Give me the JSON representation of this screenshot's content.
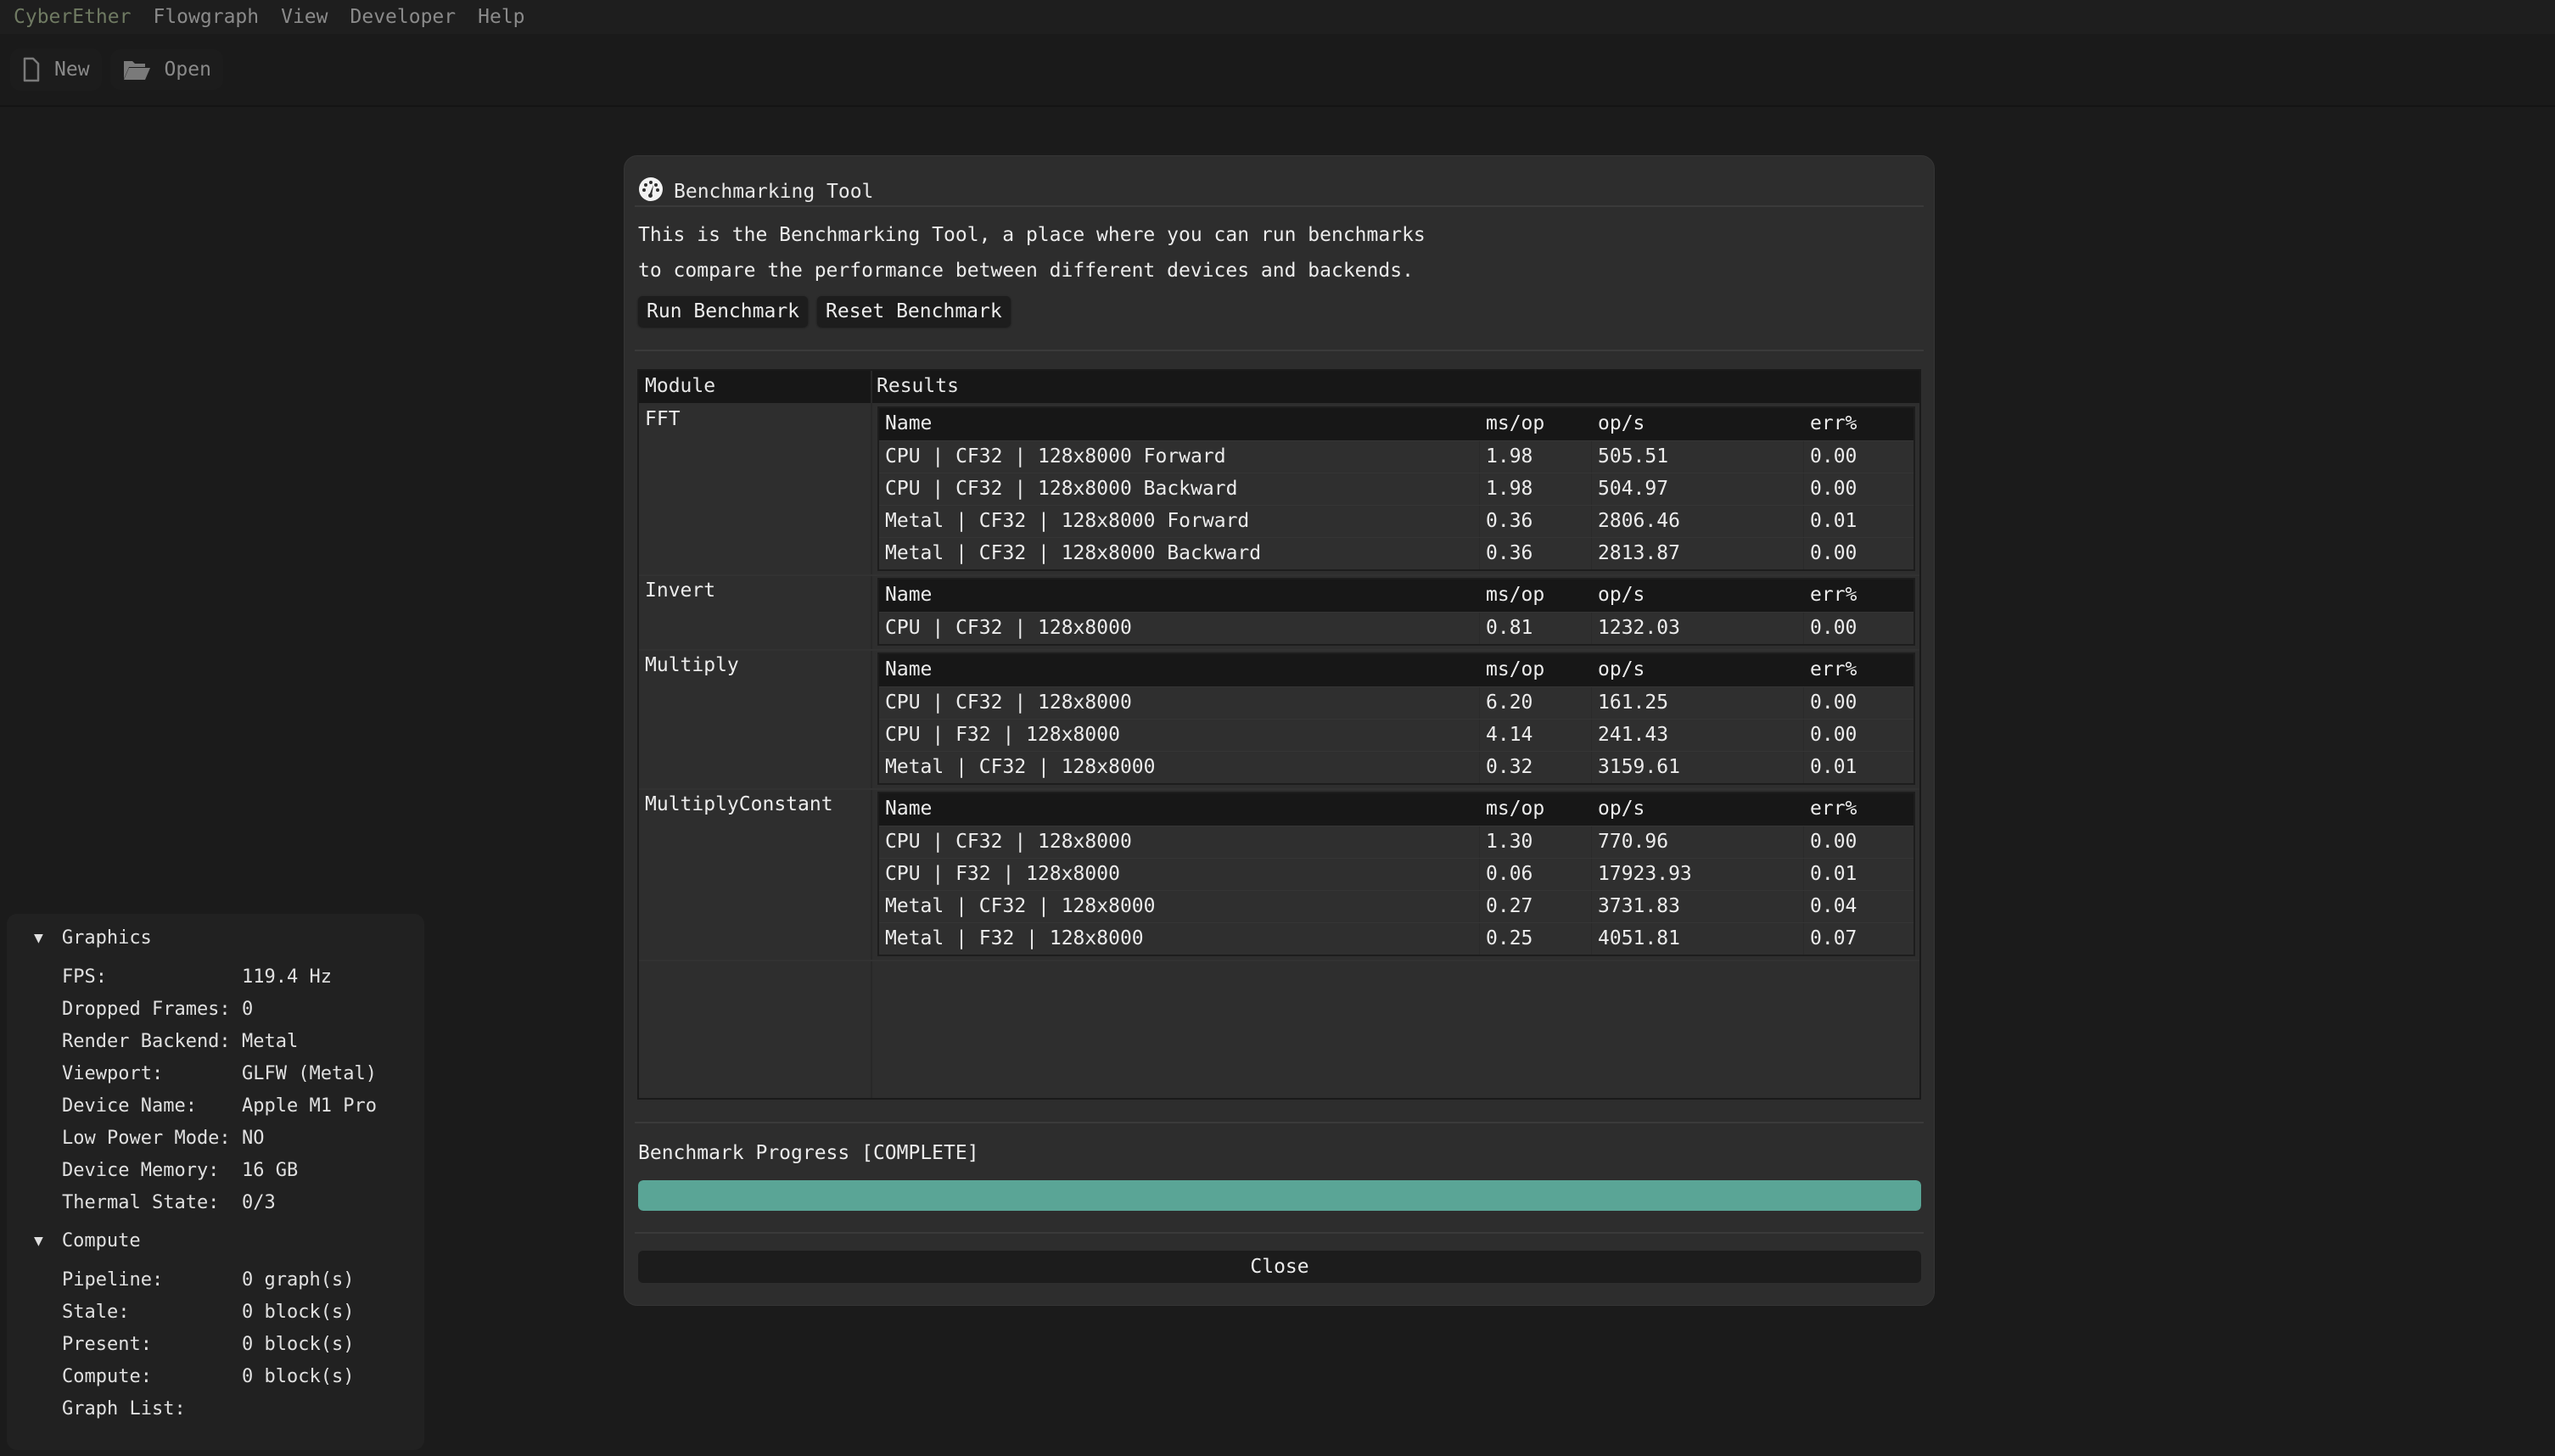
{
  "menubar": {
    "brand": "CyberEther",
    "items": [
      "Flowgraph",
      "View",
      "Developer",
      "Help"
    ]
  },
  "toolbar": {
    "new_label": "New",
    "open_label": "Open",
    "new_icon": "file-icon",
    "open_icon": "folder-open-icon"
  },
  "dialog": {
    "title": "Benchmarking Tool",
    "title_icon": "gauge-icon",
    "description_line1": "This is the Benchmarking Tool, a place where you can run benchmarks",
    "description_line2": "to compare the performance between different devices and backends.",
    "run_button": "Run Benchmark",
    "reset_button": "Reset Benchmark",
    "table": {
      "module_header": "Module",
      "results_header": "Results",
      "columns": [
        "Name",
        "ms/op",
        "op/s",
        "err%"
      ],
      "modules": [
        {
          "name": "FFT",
          "rows": [
            {
              "name": "CPU | CF32 | 128x8000 Forward",
              "ms_op": "1.98",
              "ops": "505.51",
              "err": "0.00"
            },
            {
              "name": "CPU | CF32 | 128x8000 Backward",
              "ms_op": "1.98",
              "ops": "504.97",
              "err": "0.00"
            },
            {
              "name": "Metal | CF32 | 128x8000 Forward",
              "ms_op": "0.36",
              "ops": "2806.46",
              "err": "0.01"
            },
            {
              "name": "Metal | CF32 | 128x8000 Backward",
              "ms_op": "0.36",
              "ops": "2813.87",
              "err": "0.00"
            }
          ]
        },
        {
          "name": "Invert",
          "rows": [
            {
              "name": "CPU | CF32 | 128x8000",
              "ms_op": "0.81",
              "ops": "1232.03",
              "err": "0.00"
            }
          ]
        },
        {
          "name": "Multiply",
          "rows": [
            {
              "name": "CPU | CF32 | 128x8000",
              "ms_op": "6.20",
              "ops": "161.25",
              "err": "0.00"
            },
            {
              "name": "CPU | F32 | 128x8000",
              "ms_op": "4.14",
              "ops": "241.43",
              "err": "0.00"
            },
            {
              "name": "Metal | CF32 | 128x8000",
              "ms_op": "0.32",
              "ops": "3159.61",
              "err": "0.01"
            }
          ]
        },
        {
          "name": "MultiplyConstant",
          "rows": [
            {
              "name": "CPU | CF32 | 128x8000",
              "ms_op": "1.30",
              "ops": "770.96",
              "err": "0.00"
            },
            {
              "name": "CPU | F32 | 128x8000",
              "ms_op": "0.06",
              "ops": "17923.93",
              "err": "0.01"
            },
            {
              "name": "Metal | CF32 | 128x8000",
              "ms_op": "0.27",
              "ops": "3731.83",
              "err": "0.04"
            },
            {
              "name": "Metal | F32 | 128x8000",
              "ms_op": "0.25",
              "ops": "4051.81",
              "err": "0.07"
            }
          ]
        }
      ]
    },
    "progress_label": "Benchmark Progress [COMPLETE]",
    "progress_fraction": 1.0,
    "progress_color": "#5aa596",
    "close_button": "Close"
  },
  "stats": {
    "graphics": {
      "title": "Graphics",
      "rows": [
        {
          "label": "FPS:",
          "value": "119.4 Hz"
        },
        {
          "label": "Dropped Frames:",
          "value": "0"
        },
        {
          "label": "Render Backend:",
          "value": "Metal"
        },
        {
          "label": "Viewport:",
          "value": "GLFW (Metal)"
        },
        {
          "label": "Device Name:",
          "value": "Apple M1 Pro"
        },
        {
          "label": "Low Power Mode:",
          "value": "NO"
        },
        {
          "label": "Device Memory:",
          "value": "16 GB"
        },
        {
          "label": "Thermal State:",
          "value": "0/3"
        }
      ]
    },
    "compute": {
      "title": "Compute",
      "rows": [
        {
          "label": "Pipeline:",
          "value": "0 graph(s)"
        },
        {
          "label": "Stale:",
          "value": "0 block(s)"
        },
        {
          "label": "Present:",
          "value": "0 block(s)"
        },
        {
          "label": "Compute:",
          "value": "0 block(s)"
        },
        {
          "label": "Graph List:",
          "value": ""
        }
      ]
    }
  }
}
